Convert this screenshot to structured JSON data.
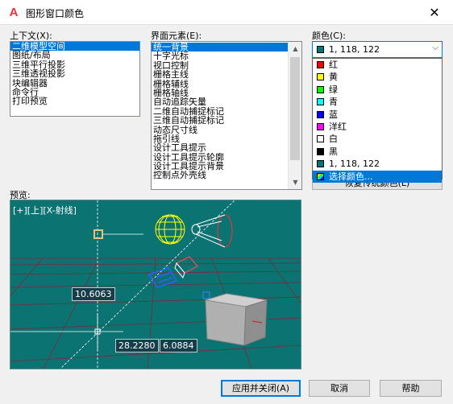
{
  "window": {
    "title": "图形窗口颜色",
    "close": "✕"
  },
  "context": {
    "label": "上下文(X):",
    "items": [
      "二维模型空间",
      "图纸/布局",
      "三维平行投影",
      "三维透视投影",
      "块编辑器",
      "命令行",
      "打印预览"
    ],
    "selected": 0
  },
  "elements": {
    "label": "界面元素(E):",
    "items": [
      "统一背景",
      "十字光标",
      "视口控制",
      "栅格主线",
      "栅格辅线",
      "栅格轴线",
      "自动追踪矢量",
      "二维自动捕捉标记",
      "三维自动捕捉标记",
      "动态尺寸线",
      "拖引线",
      "设计工具提示",
      "设计工具提示轮廓",
      "设计工具提示背景",
      "控制点外壳线"
    ],
    "selected": 0
  },
  "color": {
    "label": "颜色(C):",
    "current": "1, 118, 122",
    "current_swatch": "#01767a",
    "options": [
      {
        "label": "红",
        "swatch": "#ff0000"
      },
      {
        "label": "黄",
        "swatch": "#ffff00"
      },
      {
        "label": "绿",
        "swatch": "#00ff00"
      },
      {
        "label": "青",
        "swatch": "#00ffff"
      },
      {
        "label": "蓝",
        "swatch": "#0000ff"
      },
      {
        "label": "洋红",
        "swatch": "#ff00ff"
      },
      {
        "label": "白",
        "swatch": "#ffffff"
      },
      {
        "label": "黑",
        "swatch": "#000000"
      },
      {
        "label": "1, 118, 122",
        "swatch": "#01767a"
      },
      {
        "label": "选择颜色...",
        "swatch": "multicolor"
      }
    ],
    "selected_option": 9,
    "restore_button": "恢复传统颜色(L)"
  },
  "preview": {
    "label": "预览:",
    "viewport_label": "[+][上][X-射线]",
    "dim1": "10.6063",
    "dim2": "28.2280",
    "dim3": "6.0884"
  },
  "buttons": {
    "apply_close": "应用并关闭(A)",
    "cancel": "取消",
    "help": "帮助"
  }
}
